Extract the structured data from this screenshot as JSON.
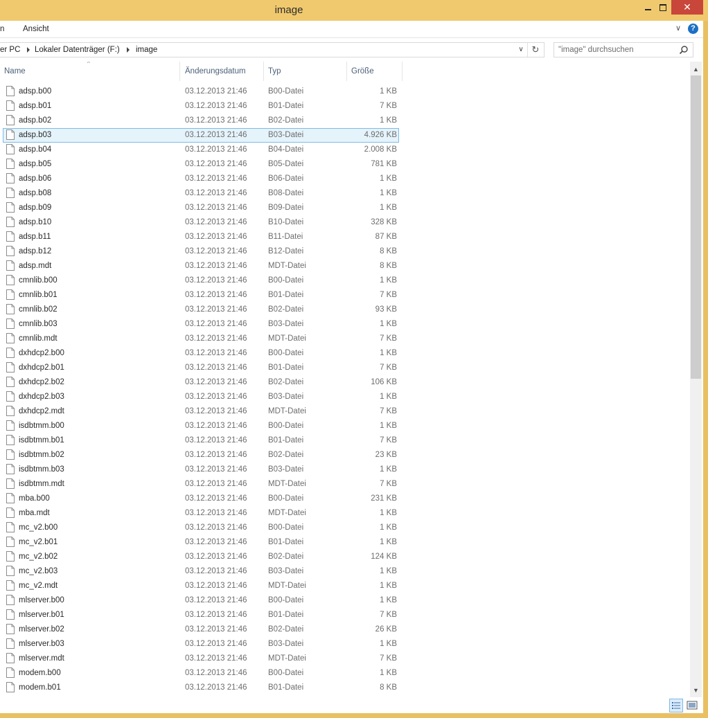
{
  "window": {
    "title": "image",
    "close_symbol": "✕"
  },
  "ribbon": {
    "tabs": [
      "n",
      "Ansicht"
    ],
    "chevron": "∨",
    "help": "?"
  },
  "address": {
    "crumbs": [
      "er PC",
      "Lokaler Datenträger (F:)",
      "image"
    ],
    "dropdown": "∨",
    "refresh": "↻"
  },
  "search": {
    "placeholder": "\"image\" durchsuchen"
  },
  "columns": {
    "name": "Name",
    "date": "Änderungsdatum",
    "type": "Typ",
    "size": "Größe",
    "sort_indicator": "^"
  },
  "files": [
    {
      "name": "adsp.b00",
      "date": "03.12.2013 21:46",
      "type": "B00-Datei",
      "size": "1 KB"
    },
    {
      "name": "adsp.b01",
      "date": "03.12.2013 21:46",
      "type": "B01-Datei",
      "size": "7 KB"
    },
    {
      "name": "adsp.b02",
      "date": "03.12.2013 21:46",
      "type": "B02-Datei",
      "size": "1 KB"
    },
    {
      "name": "adsp.b03",
      "date": "03.12.2013 21:46",
      "type": "B03-Datei",
      "size": "4.926 KB",
      "selected": true
    },
    {
      "name": "adsp.b04",
      "date": "03.12.2013 21:46",
      "type": "B04-Datei",
      "size": "2.008 KB"
    },
    {
      "name": "adsp.b05",
      "date": "03.12.2013 21:46",
      "type": "B05-Datei",
      "size": "781 KB"
    },
    {
      "name": "adsp.b06",
      "date": "03.12.2013 21:46",
      "type": "B06-Datei",
      "size": "1 KB"
    },
    {
      "name": "adsp.b08",
      "date": "03.12.2013 21:46",
      "type": "B08-Datei",
      "size": "1 KB"
    },
    {
      "name": "adsp.b09",
      "date": "03.12.2013 21:46",
      "type": "B09-Datei",
      "size": "1 KB"
    },
    {
      "name": "adsp.b10",
      "date": "03.12.2013 21:46",
      "type": "B10-Datei",
      "size": "328 KB"
    },
    {
      "name": "adsp.b11",
      "date": "03.12.2013 21:46",
      "type": "B11-Datei",
      "size": "87 KB"
    },
    {
      "name": "adsp.b12",
      "date": "03.12.2013 21:46",
      "type": "B12-Datei",
      "size": "8 KB"
    },
    {
      "name": "adsp.mdt",
      "date": "03.12.2013 21:46",
      "type": "MDT-Datei",
      "size": "8 KB"
    },
    {
      "name": "cmnlib.b00",
      "date": "03.12.2013 21:46",
      "type": "B00-Datei",
      "size": "1 KB"
    },
    {
      "name": "cmnlib.b01",
      "date": "03.12.2013 21:46",
      "type": "B01-Datei",
      "size": "7 KB"
    },
    {
      "name": "cmnlib.b02",
      "date": "03.12.2013 21:46",
      "type": "B02-Datei",
      "size": "93 KB"
    },
    {
      "name": "cmnlib.b03",
      "date": "03.12.2013 21:46",
      "type": "B03-Datei",
      "size": "1 KB"
    },
    {
      "name": "cmnlib.mdt",
      "date": "03.12.2013 21:46",
      "type": "MDT-Datei",
      "size": "7 KB"
    },
    {
      "name": "dxhdcp2.b00",
      "date": "03.12.2013 21:46",
      "type": "B00-Datei",
      "size": "1 KB"
    },
    {
      "name": "dxhdcp2.b01",
      "date": "03.12.2013 21:46",
      "type": "B01-Datei",
      "size": "7 KB"
    },
    {
      "name": "dxhdcp2.b02",
      "date": "03.12.2013 21:46",
      "type": "B02-Datei",
      "size": "106 KB"
    },
    {
      "name": "dxhdcp2.b03",
      "date": "03.12.2013 21:46",
      "type": "B03-Datei",
      "size": "1 KB"
    },
    {
      "name": "dxhdcp2.mdt",
      "date": "03.12.2013 21:46",
      "type": "MDT-Datei",
      "size": "7 KB"
    },
    {
      "name": "isdbtmm.b00",
      "date": "03.12.2013 21:46",
      "type": "B00-Datei",
      "size": "1 KB"
    },
    {
      "name": "isdbtmm.b01",
      "date": "03.12.2013 21:46",
      "type": "B01-Datei",
      "size": "7 KB"
    },
    {
      "name": "isdbtmm.b02",
      "date": "03.12.2013 21:46",
      "type": "B02-Datei",
      "size": "23 KB"
    },
    {
      "name": "isdbtmm.b03",
      "date": "03.12.2013 21:46",
      "type": "B03-Datei",
      "size": "1 KB"
    },
    {
      "name": "isdbtmm.mdt",
      "date": "03.12.2013 21:46",
      "type": "MDT-Datei",
      "size": "7 KB"
    },
    {
      "name": "mba.b00",
      "date": "03.12.2013 21:46",
      "type": "B00-Datei",
      "size": "231 KB"
    },
    {
      "name": "mba.mdt",
      "date": "03.12.2013 21:46",
      "type": "MDT-Datei",
      "size": "1 KB"
    },
    {
      "name": "mc_v2.b00",
      "date": "03.12.2013 21:46",
      "type": "B00-Datei",
      "size": "1 KB"
    },
    {
      "name": "mc_v2.b01",
      "date": "03.12.2013 21:46",
      "type": "B01-Datei",
      "size": "1 KB"
    },
    {
      "name": "mc_v2.b02",
      "date": "03.12.2013 21:46",
      "type": "B02-Datei",
      "size": "124 KB"
    },
    {
      "name": "mc_v2.b03",
      "date": "03.12.2013 21:46",
      "type": "B03-Datei",
      "size": "1 KB"
    },
    {
      "name": "mc_v2.mdt",
      "date": "03.12.2013 21:46",
      "type": "MDT-Datei",
      "size": "1 KB"
    },
    {
      "name": "mlserver.b00",
      "date": "03.12.2013 21:46",
      "type": "B00-Datei",
      "size": "1 KB"
    },
    {
      "name": "mlserver.b01",
      "date": "03.12.2013 21:46",
      "type": "B01-Datei",
      "size": "7 KB"
    },
    {
      "name": "mlserver.b02",
      "date": "03.12.2013 21:46",
      "type": "B02-Datei",
      "size": "26 KB"
    },
    {
      "name": "mlserver.b03",
      "date": "03.12.2013 21:46",
      "type": "B03-Datei",
      "size": "1 KB"
    },
    {
      "name": "mlserver.mdt",
      "date": "03.12.2013 21:46",
      "type": "MDT-Datei",
      "size": "7 KB"
    },
    {
      "name": "modem.b00",
      "date": "03.12.2013 21:46",
      "type": "B00-Datei",
      "size": "1 KB"
    },
    {
      "name": "modem.b01",
      "date": "03.12.2013 21:46",
      "type": "B01-Datei",
      "size": "8 KB"
    }
  ],
  "icons": {
    "file": "file-icon",
    "search": "search-icon",
    "details_view": "details-view-icon",
    "large_icons_view": "large-icons-view-icon"
  },
  "colors": {
    "title_bar": "#f0c96e",
    "close_button": "#c9463a",
    "selection_fill": "#e5f3fb",
    "selection_border": "#7dbbe6",
    "help_icon": "#1d6fc4"
  }
}
